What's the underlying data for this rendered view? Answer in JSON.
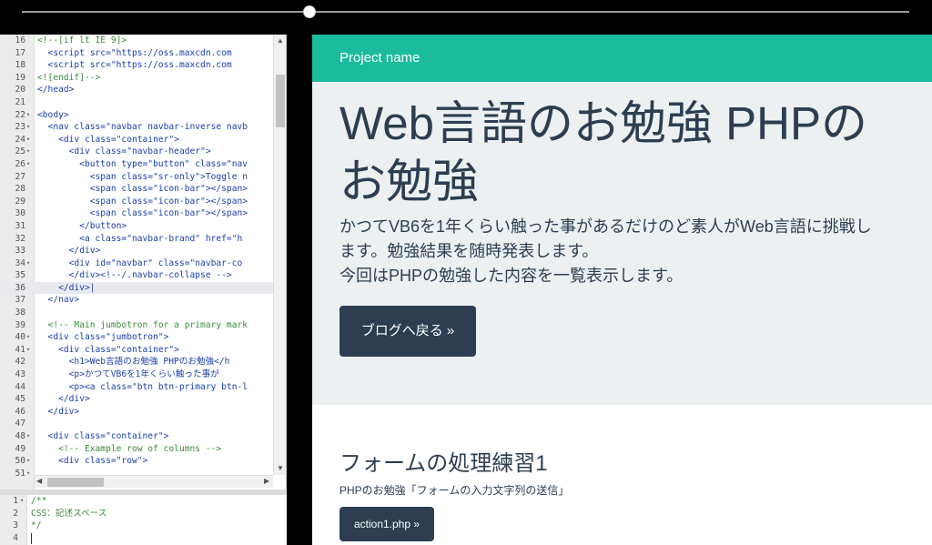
{
  "slider": {
    "value_fraction": 0.34
  },
  "code_editor": {
    "lines": [
      {
        "num": "16",
        "fold": "",
        "text": "<!--[if lt IE 9]>",
        "comment": true
      },
      {
        "num": "17",
        "fold": "",
        "text": "  <script src=\"https://oss.maxcdn.com",
        "comment": false
      },
      {
        "num": "18",
        "fold": "",
        "text": "  <script src=\"https://oss.maxcdn.com",
        "comment": false
      },
      {
        "num": "19",
        "fold": "",
        "text": "<![endif]-->",
        "comment": true
      },
      {
        "num": "20",
        "fold": "",
        "text": "</head>",
        "comment": false
      },
      {
        "num": "21",
        "fold": "",
        "text": "",
        "comment": false
      },
      {
        "num": "22",
        "fold": "▾",
        "text": "<body>",
        "comment": false
      },
      {
        "num": "23",
        "fold": "▾",
        "text": "  <nav class=\"navbar navbar-inverse navb",
        "comment": false
      },
      {
        "num": "24",
        "fold": "▾",
        "text": "    <div class=\"container\">",
        "comment": false
      },
      {
        "num": "25",
        "fold": "▾",
        "text": "      <div class=\"navbar-header\">",
        "comment": false
      },
      {
        "num": "26",
        "fold": "▾",
        "text": "        <button type=\"button\" class=\"nav",
        "comment": false
      },
      {
        "num": "27",
        "fold": "",
        "text": "          <span class=\"sr-only\">Toggle n",
        "comment": false
      },
      {
        "num": "28",
        "fold": "",
        "text": "          <span class=\"icon-bar\"></span>",
        "comment": false
      },
      {
        "num": "29",
        "fold": "",
        "text": "          <span class=\"icon-bar\"></span>",
        "comment": false
      },
      {
        "num": "30",
        "fold": "",
        "text": "          <span class=\"icon-bar\"></span>",
        "comment": false
      },
      {
        "num": "31",
        "fold": "",
        "text": "        </button>",
        "comment": false
      },
      {
        "num": "32",
        "fold": "",
        "text": "        <a class=\"navbar-brand\" href=\"h",
        "comment": false
      },
      {
        "num": "33",
        "fold": "",
        "text": "      </div>",
        "comment": false
      },
      {
        "num": "34",
        "fold": "▾",
        "text": "      <div id=\"navbar\" class=\"navbar-co",
        "comment": false
      },
      {
        "num": "35",
        "fold": "",
        "text": "      </div><!--/.navbar-collapse -->",
        "comment": false
      },
      {
        "num": "36",
        "fold": "",
        "text": "    </div>|",
        "comment": false
      },
      {
        "num": "37",
        "fold": "",
        "text": "  </nav>",
        "comment": false
      },
      {
        "num": "38",
        "fold": "",
        "text": "",
        "comment": false
      },
      {
        "num": "39",
        "fold": "",
        "text": "  <!-- Main jumbotron for a primary mark",
        "comment": true
      },
      {
        "num": "40",
        "fold": "▾",
        "text": "  <div class=\"jumbotron\">",
        "comment": false
      },
      {
        "num": "41",
        "fold": "▾",
        "text": "    <div class=\"container\">",
        "comment": false
      },
      {
        "num": "42",
        "fold": "",
        "text": "      <h1>Web言語のお勉強 PHPのお勉強</h",
        "comment": false
      },
      {
        "num": "43",
        "fold": "",
        "text": "      <p>かつてVB6を1年くらい触った事が",
        "comment": false
      },
      {
        "num": "44",
        "fold": "",
        "text": "      <p><a class=\"btn btn-primary btn-l",
        "comment": false
      },
      {
        "num": "45",
        "fold": "",
        "text": "    </div>",
        "comment": false
      },
      {
        "num": "46",
        "fold": "",
        "text": "  </div>",
        "comment": false
      },
      {
        "num": "47",
        "fold": "",
        "text": "",
        "comment": false
      },
      {
        "num": "48",
        "fold": "▾",
        "text": "  <div class=\"container\">",
        "comment": false
      },
      {
        "num": "49",
        "fold": "",
        "text": "    <!-- Example row of columns -->",
        "comment": true
      },
      {
        "num": "50",
        "fold": "▾",
        "text": "    <div class=\"row\">",
        "comment": false
      },
      {
        "num": "51",
        "fold": "▾",
        "text": "",
        "comment": false
      }
    ],
    "active_line": "36"
  },
  "css_editor": {
    "lines": [
      {
        "num": "1",
        "fold": "▾",
        "text": "/**"
      },
      {
        "num": "2",
        "fold": "",
        "text": "CSS：記述スペース"
      },
      {
        "num": "3",
        "fold": "",
        "text": "*/"
      },
      {
        "num": "4",
        "fold": "",
        "text": ""
      }
    ]
  },
  "preview": {
    "brand": "Project name",
    "title": "Web言語のお勉強 PHPのお勉強",
    "lead": "かつてVB6を1年くらい触った事があるだけのど素人がWeb言語に挑戦します。勉強結果を随時発表します。\n今回はPHPの勉強した内容を一覧表示します。",
    "lead_line1": "かつてVB6を1年くらい触った事があるだけのど素人がWeb言語に挑戦し",
    "lead_line2": "ます。勉強結果を随時発表します。",
    "lead_line3": "今回はPHPの勉強した内容を一覧表示します。",
    "back_button": "ブログへ戻る »",
    "section_title": "フォームの処理練習1",
    "section_text": "PHPのお勉強「フォームの入力文字列の送信」",
    "action_button": "action1.php »"
  },
  "colors": {
    "navbar": "#1abc9c",
    "jumbotron_bg": "#ecf0f1",
    "text": "#2c3e50",
    "button": "#2c3e50"
  }
}
